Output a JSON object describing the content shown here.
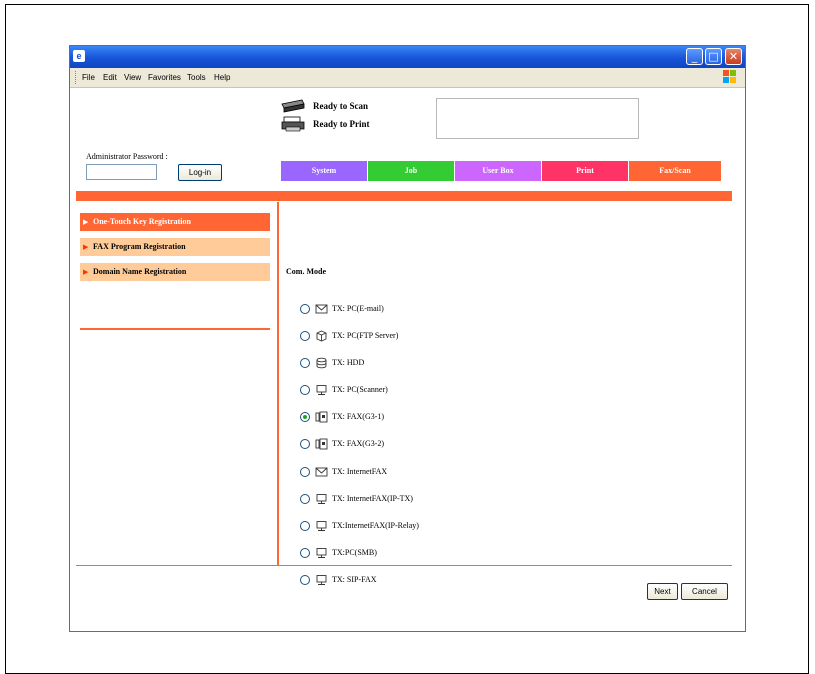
{
  "menu": {
    "file": "File",
    "edit": "Edit",
    "view": "View",
    "favorites": "Favorites",
    "tools": "Tools",
    "help": "Help"
  },
  "status": {
    "scan": "Ready to Scan",
    "print": "Ready to Print"
  },
  "login": {
    "label": "Administrator Password :",
    "password_value": "",
    "button": "Log-in"
  },
  "tabs": [
    {
      "label": "System",
      "color": "#9966ff"
    },
    {
      "label": "Job",
      "color": "#33cc33"
    },
    {
      "label": "User Box",
      "color": "#cc66ff"
    },
    {
      "label": "Print",
      "color": "#ff3366"
    },
    {
      "label": "Fax/Scan",
      "color": "#ff6633"
    }
  ],
  "sidebar": {
    "items": [
      {
        "label": "One-Touch Key Registration",
        "active": true
      },
      {
        "label": "FAX Program Registration",
        "active": false
      },
      {
        "label": "Domain Name Registration",
        "active": false
      }
    ]
  },
  "main": {
    "title": "Com. Mode",
    "options": [
      {
        "label": "TX: PC(E-mail)",
        "icon": "envelope-icon",
        "selected": false
      },
      {
        "label": "TX: PC(FTP Server)",
        "icon": "ftp-server-icon",
        "selected": false
      },
      {
        "label": "TX: HDD",
        "icon": "hdd-icon",
        "selected": false
      },
      {
        "label": "TX: PC(Scanner)",
        "icon": "pc-icon",
        "selected": false
      },
      {
        "label": "TX: FAX(G3-1)",
        "icon": "fax-icon",
        "selected": true
      },
      {
        "label": "TX: FAX(G3-2)",
        "icon": "fax-icon",
        "selected": false
      },
      {
        "label": "TX: InternetFAX",
        "icon": "envelope-icon",
        "selected": false
      },
      {
        "label": "TX: InternetFAX(IP-TX)",
        "icon": "pc-icon",
        "selected": false
      },
      {
        "label": "TX:InternetFAX(IP-Relay)",
        "icon": "pc-icon",
        "selected": false
      },
      {
        "label": "TX:PC(SMB)",
        "icon": "pc-icon",
        "selected": false
      },
      {
        "label": "TX: SIP-FAX",
        "icon": "pc-icon",
        "selected": false
      }
    ]
  },
  "footer": {
    "next": "Next",
    "cancel": "Cancel"
  }
}
